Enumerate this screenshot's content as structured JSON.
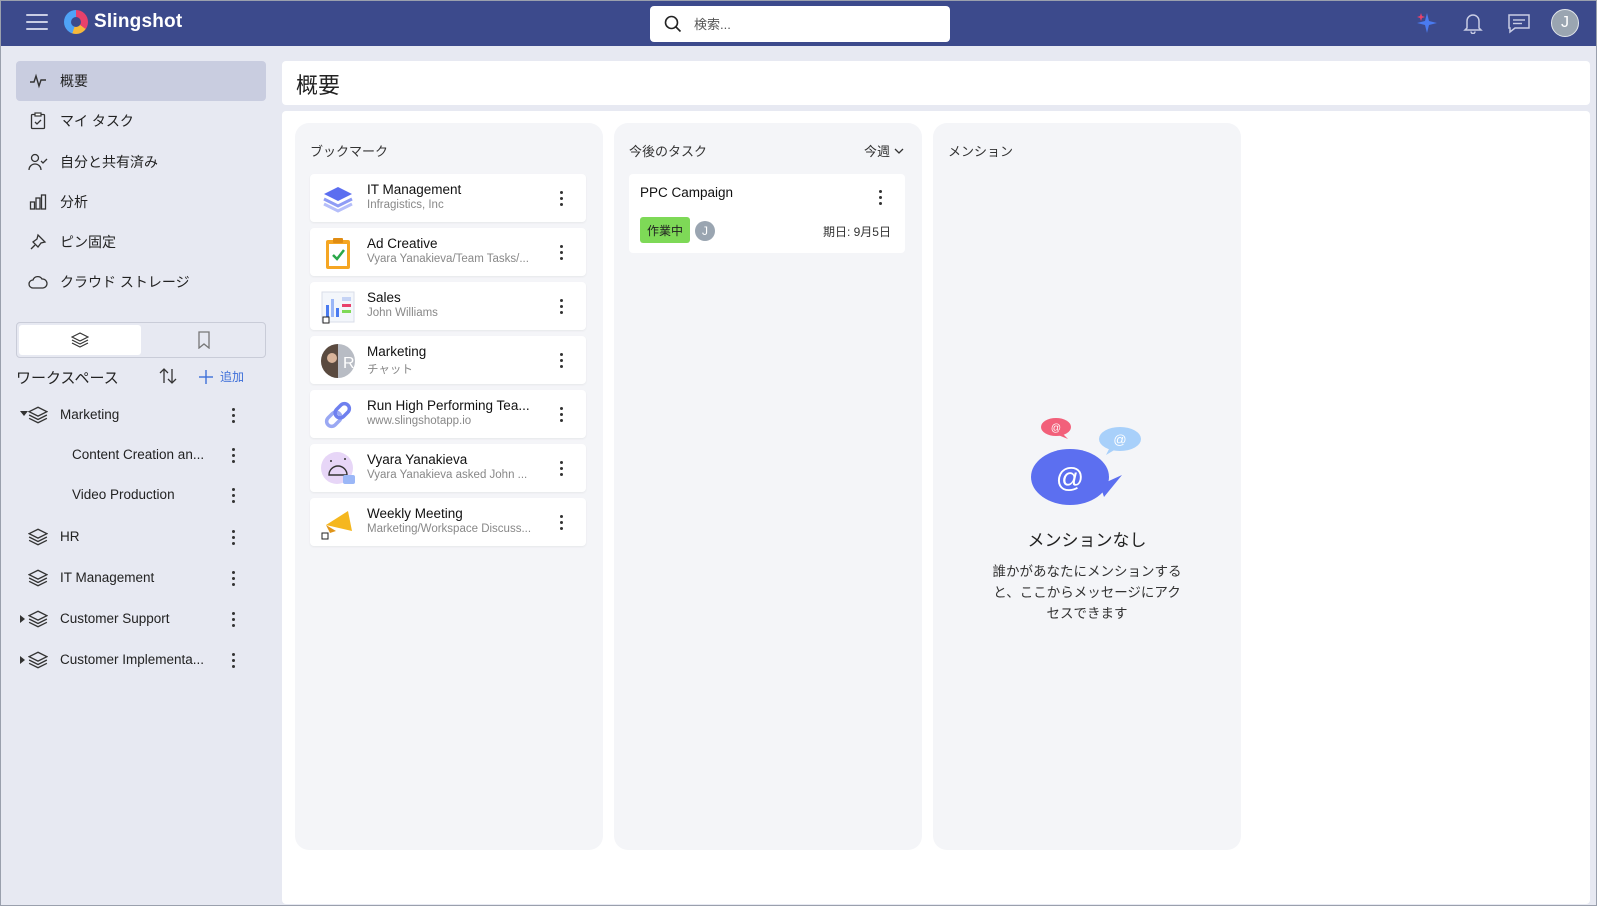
{
  "app": {
    "name": "Slingshot",
    "brand_color": "#3c4a8c"
  },
  "search": {
    "placeholder": "検索..."
  },
  "topbar": {
    "icons": [
      "sparkle-icon",
      "bell-icon",
      "chat-icon"
    ],
    "user_initial": "J"
  },
  "nav": {
    "items": [
      {
        "label": "概要",
        "icon": "activity-icon",
        "active": true
      },
      {
        "label": "マイ タスク",
        "icon": "clipboard-check-icon"
      },
      {
        "label": "自分と共有済み",
        "icon": "user-check-icon"
      },
      {
        "label": "分析",
        "icon": "bar-chart-icon"
      },
      {
        "label": "ピン固定",
        "icon": "pin-icon"
      },
      {
        "label": "クラウド ストレージ",
        "icon": "cloud-icon"
      }
    ]
  },
  "workspaces": {
    "title": "ワークスペース",
    "add_label": "追加",
    "items": [
      {
        "label": "Marketing",
        "expanded": true
      },
      {
        "label": "Content Creation an..."
      },
      {
        "label": "Video Production"
      },
      {
        "label": "HR"
      },
      {
        "label": "IT Management"
      },
      {
        "label": "Customer Support"
      },
      {
        "label": "Customer Implementa..."
      }
    ]
  },
  "page": {
    "title": "概要"
  },
  "bookmarks": {
    "title": "ブックマーク",
    "items": [
      {
        "title": "IT Management",
        "subtitle": "Infragistics, Inc"
      },
      {
        "title": "Ad Creative",
        "subtitle": "Vyara Yanakieva/Team Tasks/..."
      },
      {
        "title": "Sales",
        "subtitle": "John Williams"
      },
      {
        "title": "Marketing",
        "subtitle": "チャット"
      },
      {
        "title": "Run High Performing Tea...",
        "subtitle": "www.slingshotapp.io"
      },
      {
        "title": "Vyara Yanakieva",
        "subtitle": "Vyara Yanakieva asked John ..."
      },
      {
        "title": "Weekly Meeting",
        "subtitle": "Marketing/Workspace Discuss..."
      }
    ]
  },
  "tasks": {
    "title": "今後のタスク",
    "filter": "今週",
    "items": [
      {
        "title": "PPC Campaign",
        "status": "作業中",
        "status_color": "#7ed957",
        "assignee": "J",
        "due": "期日: 9月5日"
      }
    ]
  },
  "mentions": {
    "title": "メンション",
    "empty_title": "メンションなし",
    "empty_desc": "誰かがあなたにメンションすると、ここからメッセージにアクセスできます",
    "bubble_symbol": "@"
  }
}
